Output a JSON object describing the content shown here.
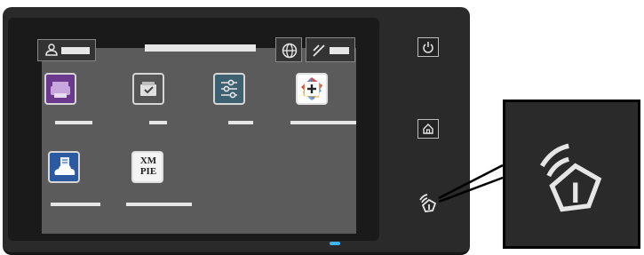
{
  "panel": {
    "accent_led_color": "#3fb2f0",
    "display_bg": "#5b5b5b"
  },
  "topbar": {
    "user_icon": "person-icon",
    "language_icon": "globe-icon",
    "status_icon": "wifi-slash-icon"
  },
  "apps": [
    {
      "icon": "printer-icon",
      "color": "#6b3a8e"
    },
    {
      "icon": "jobs-check-icon",
      "color": "#666666"
    },
    {
      "icon": "sliders-icon",
      "color": "#3d6170"
    },
    {
      "icon": "add-app-icon",
      "color": "#ffffff"
    },
    {
      "icon": "cloud-print-icon",
      "color": "#2c5aa0"
    },
    {
      "icon": "xmpie-icon",
      "color": "#ffffff"
    }
  ],
  "xmpie": {
    "line1": "XM",
    "line2": "PIE"
  },
  "hardware": {
    "power_icon": "power-icon",
    "home_icon": "home-icon",
    "nfc_icon": "nfc-icon"
  }
}
